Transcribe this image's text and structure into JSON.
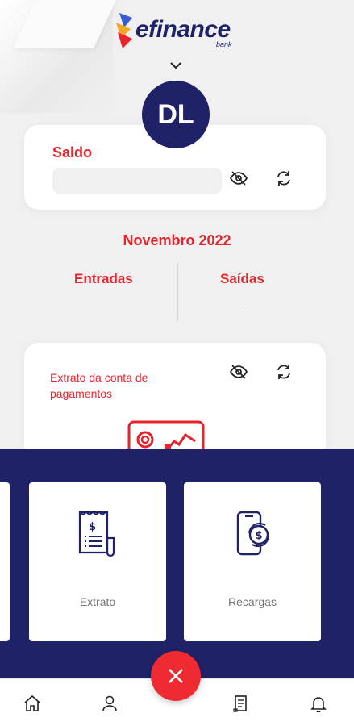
{
  "header": {
    "logo_text": "efinance",
    "logo_sub": "bank",
    "expand_icon": "chevron-down-icon"
  },
  "profile": {
    "initials": "DL"
  },
  "balance": {
    "label": "Saldo",
    "hide_icon": "eye-off-icon",
    "refresh_icon": "refresh-icon"
  },
  "summary": {
    "month": "Novembro 2022",
    "income_label": "Entradas",
    "expenses_label": "Saídas",
    "expenses_value": "-"
  },
  "statement_card": {
    "title": "Extrato da conta de pagamentos",
    "hide_icon": "eye-off-icon",
    "refresh_icon": "refresh-icon"
  },
  "quick_actions": [
    {
      "label": "Extrato",
      "icon": "receipt-icon"
    },
    {
      "label": "Recargas",
      "icon": "phone-topup-icon"
    }
  ],
  "bottom_nav": [
    {
      "icon": "home-icon"
    },
    {
      "icon": "user-icon"
    },
    {
      "icon": "statement-icon"
    },
    {
      "icon": "bell-icon"
    }
  ],
  "fab": {
    "icon": "close-icon"
  },
  "colors": {
    "brand_navy": "#1f2266",
    "accent_red": "#e8232b",
    "fab_red": "#ee2b32"
  }
}
